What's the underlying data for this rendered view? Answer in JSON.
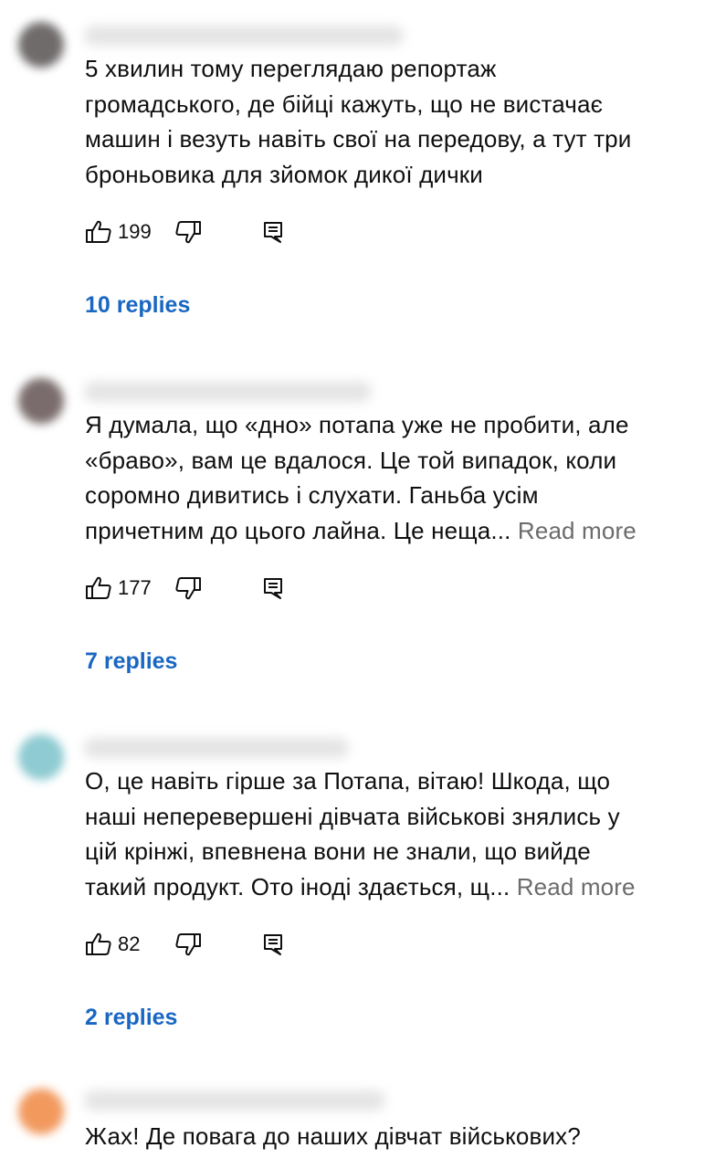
{
  "comments": [
    {
      "avatar_color": "#6f6b6b",
      "lines": [
        "5 хвилин тому переглядаю репортаж",
        "громадського, де бійці кажуть, що не вистачає",
        "машин і везуть навіть свої на передову, а тут три",
        "броньовика для зйомок дикої дички"
      ],
      "read_more": "",
      "likes": "199",
      "replies": "10 replies"
    },
    {
      "avatar_color": "#7a6c6c",
      "lines": [
        "Я думала, що «дно» потапа уже не пробити, але",
        "«браво», вам це вдалося. Це той випадок, коли",
        "соромно дивитись і слухати. Ганьба усім",
        "причетним до цього лайна. Це неща..."
      ],
      "read_more": "Read more",
      "likes": "177",
      "replies": "7 replies"
    },
    {
      "avatar_color": "#8ecbd2",
      "lines": [
        "О, це навіть гірше за Потапа, вітаю!  Шкода, що",
        "наші неперевершені дівчата  військові знялись у",
        "цій крінжі, впевнена вони не знали, що вийде",
        "такий продукт. Ото іноді здається, щ..."
      ],
      "read_more": "Read more",
      "likes": "82",
      "replies": "2 replies"
    },
    {
      "avatar_color": "#f2995e",
      "lines": [
        "Жах! Де повага до наших дівчат військових?"
      ],
      "read_more": "",
      "likes": "",
      "replies": ""
    }
  ],
  "icons": {
    "like": "thumb-up-icon",
    "dislike": "thumb-down-icon",
    "reply": "reply-comment-icon"
  },
  "colors": {
    "link_blue": "#1967c2",
    "read_more_gray": "#6b6b6b",
    "text": "#0f0f0f"
  }
}
